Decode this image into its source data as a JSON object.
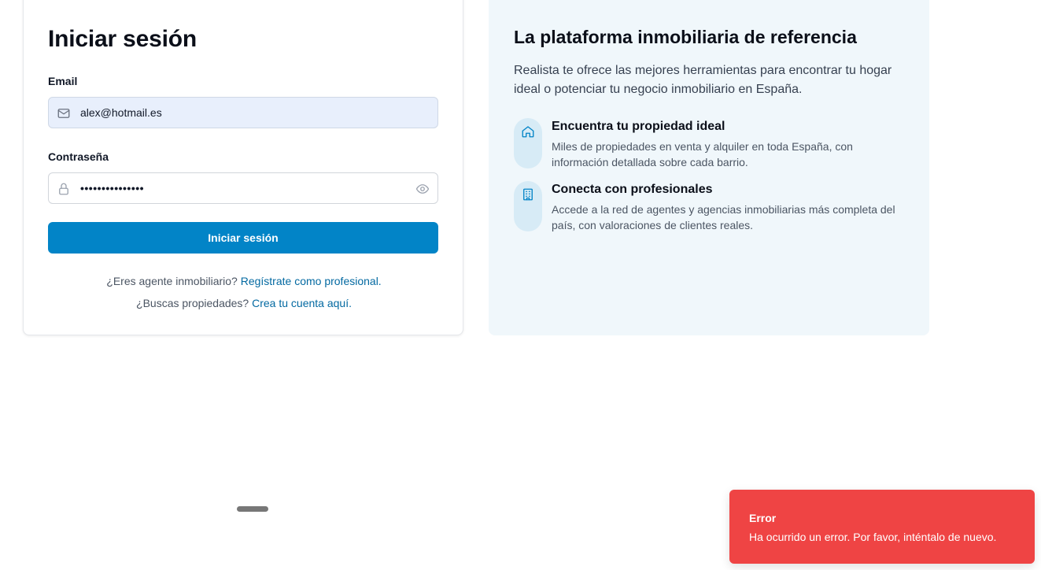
{
  "login": {
    "title": "Iniciar sesión",
    "email_label": "Email",
    "email_value": "alex@hotmail.es",
    "password_label": "Contraseña",
    "password_value": "•••••••••••••••",
    "submit_label": "Iniciar sesión",
    "agent_prompt": "¿Eres agente inmobiliario?",
    "agent_link": "Regístrate como profesional.",
    "buyer_prompt": "¿Buscas propiedades?",
    "buyer_link": "Crea tu cuenta aquí."
  },
  "info": {
    "title": "La plataforma inmobiliaria de referencia",
    "description": "Realista te ofrece las mejores herramientas para encontrar tu hogar ideal o potenciar tu negocio inmobiliario en España.",
    "features": [
      {
        "icon": "home-icon",
        "title": "Encuentra tu propiedad ideal",
        "description": "Miles de propiedades en venta y alquiler en toda España, con información detallada sobre cada barrio."
      },
      {
        "icon": "building-icon",
        "title": "Conecta con profesionales",
        "description": "Accede a la red de agentes y agencias inmobiliarias más completa del país, con valoraciones de clientes reales."
      }
    ]
  },
  "toast": {
    "title": "Error",
    "message": "Ha ocurrido un error. Por favor, inténtalo de nuevo."
  },
  "colors": {
    "primary": "#0284c7",
    "link": "#0369a1",
    "error": "#ef4444",
    "panel_bg": "#f0f7fb"
  }
}
